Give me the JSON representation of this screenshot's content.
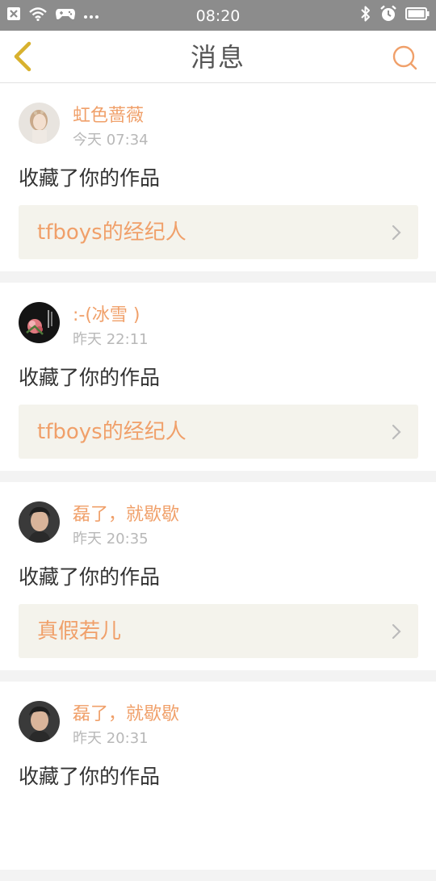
{
  "status_bar": {
    "time": "08:20",
    "left_icons": [
      "close-box-icon",
      "wifi-icon",
      "gamepad-icon",
      "more-dots-icon"
    ],
    "right_icons": [
      "bluetooth-icon",
      "alarm-icon",
      "battery-icon"
    ]
  },
  "header": {
    "title": "消息",
    "back_icon": "chevron-left-icon",
    "search_icon": "search-icon"
  },
  "colors": {
    "accent": "#f0a06a",
    "back": "#d8b12e",
    "link_bg": "#f4f3ec",
    "status_bar": "#8c8c8c"
  },
  "messages": [
    {
      "user": "虹色蔷薇",
      "time": "今天 07:34",
      "action": "收藏了你的作品",
      "work": "tfboys的经纪人"
    },
    {
      "user": ":-(冰雪 )",
      "time": "昨天 22:11",
      "action": "收藏了你的作品",
      "work": "tfboys的经纪人"
    },
    {
      "user": "磊了，就歇歇",
      "time": "昨天 20:35",
      "action": "收藏了你的作品",
      "work": "真假若儿"
    },
    {
      "user": "磊了，就歇歇",
      "time": "昨天 20:31",
      "action": "收藏了你的作品",
      "work": ""
    }
  ]
}
